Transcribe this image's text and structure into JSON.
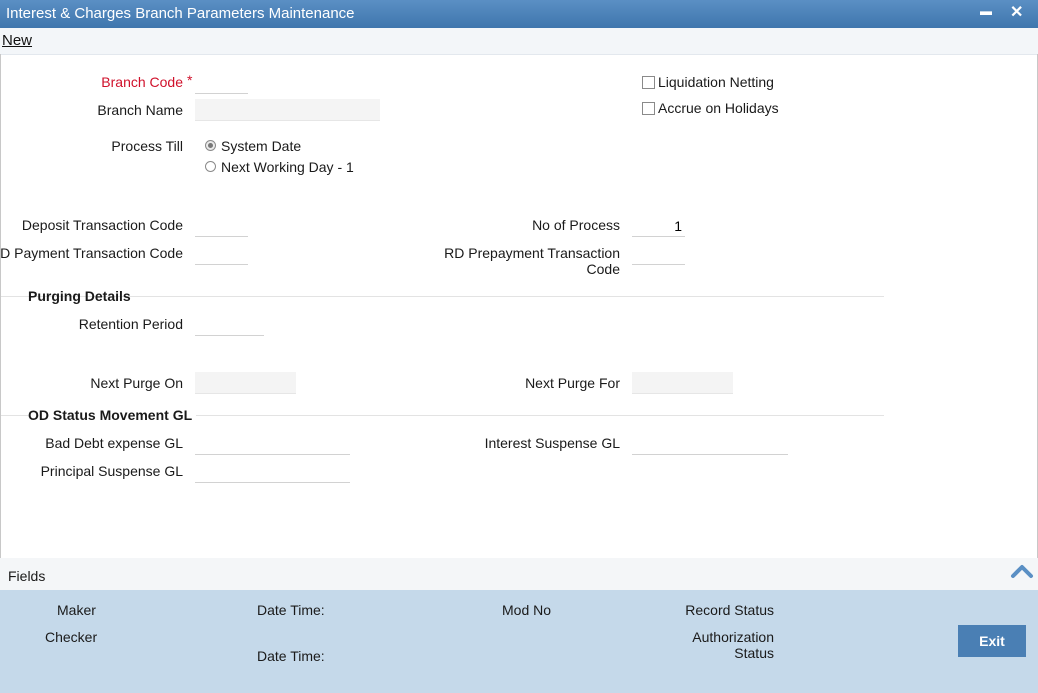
{
  "window": {
    "title": "Interest & Charges Branch Parameters Maintenance",
    "minimize_glyph": "▬",
    "close_glyph": "✕"
  },
  "toolbar": {
    "new_label": "New"
  },
  "form": {
    "branch_code": {
      "label": "Branch Code",
      "required_mark": "*",
      "value": ""
    },
    "branch_name": {
      "label": "Branch Name",
      "value": ""
    },
    "liquidation_netting": {
      "label": "Liquidation Netting",
      "checked": false
    },
    "accrue_on_holidays": {
      "label": "Accrue on Holidays",
      "checked": false
    },
    "process_till": {
      "label": "Process Till",
      "options": [
        "System Date",
        "Next Working Day - 1"
      ],
      "selected": "System Date"
    },
    "deposit_txn_code": {
      "label": "Deposit Transaction Code",
      "value": ""
    },
    "rd_payment_txn_code": {
      "label": "RD Payment Transaction Code",
      "value": ""
    },
    "no_of_process": {
      "label": "No of Process",
      "value": "1"
    },
    "rd_prepayment_txn_code": {
      "label_line1": "RD Prepayment Transaction",
      "label_line2": "Code",
      "value": ""
    }
  },
  "purging": {
    "heading": "Purging Details",
    "retention_period": {
      "label": "Retention Period",
      "value": ""
    },
    "next_purge_on": {
      "label": "Next Purge On",
      "value": ""
    },
    "next_purge_for": {
      "label": "Next Purge For",
      "value": ""
    }
  },
  "od_status": {
    "heading": "OD Status Movement GL",
    "bad_debt_expense_gl": {
      "label": "Bad Debt expense GL",
      "value": ""
    },
    "interest_suspense_gl": {
      "label": "Interest Suspense GL",
      "value": ""
    },
    "principal_suspense_gl": {
      "label": "Principal Suspense GL",
      "value": ""
    }
  },
  "fields_bar": {
    "label": "Fields"
  },
  "audit": {
    "maker": "Maker",
    "checker": "Checker",
    "date_time_1": "Date Time:",
    "date_time_2": "Date Time:",
    "mod_no": "Mod No",
    "record_status": "Record Status",
    "authorization_line1": "Authorization",
    "authorization_line2": "Status",
    "exit_label": "Exit"
  },
  "colors": {
    "title_bar": "#4a81b8",
    "required_label": "#d0112b",
    "audit_panel": "#c5d9ea",
    "exit_button": "#4a7fb4"
  }
}
